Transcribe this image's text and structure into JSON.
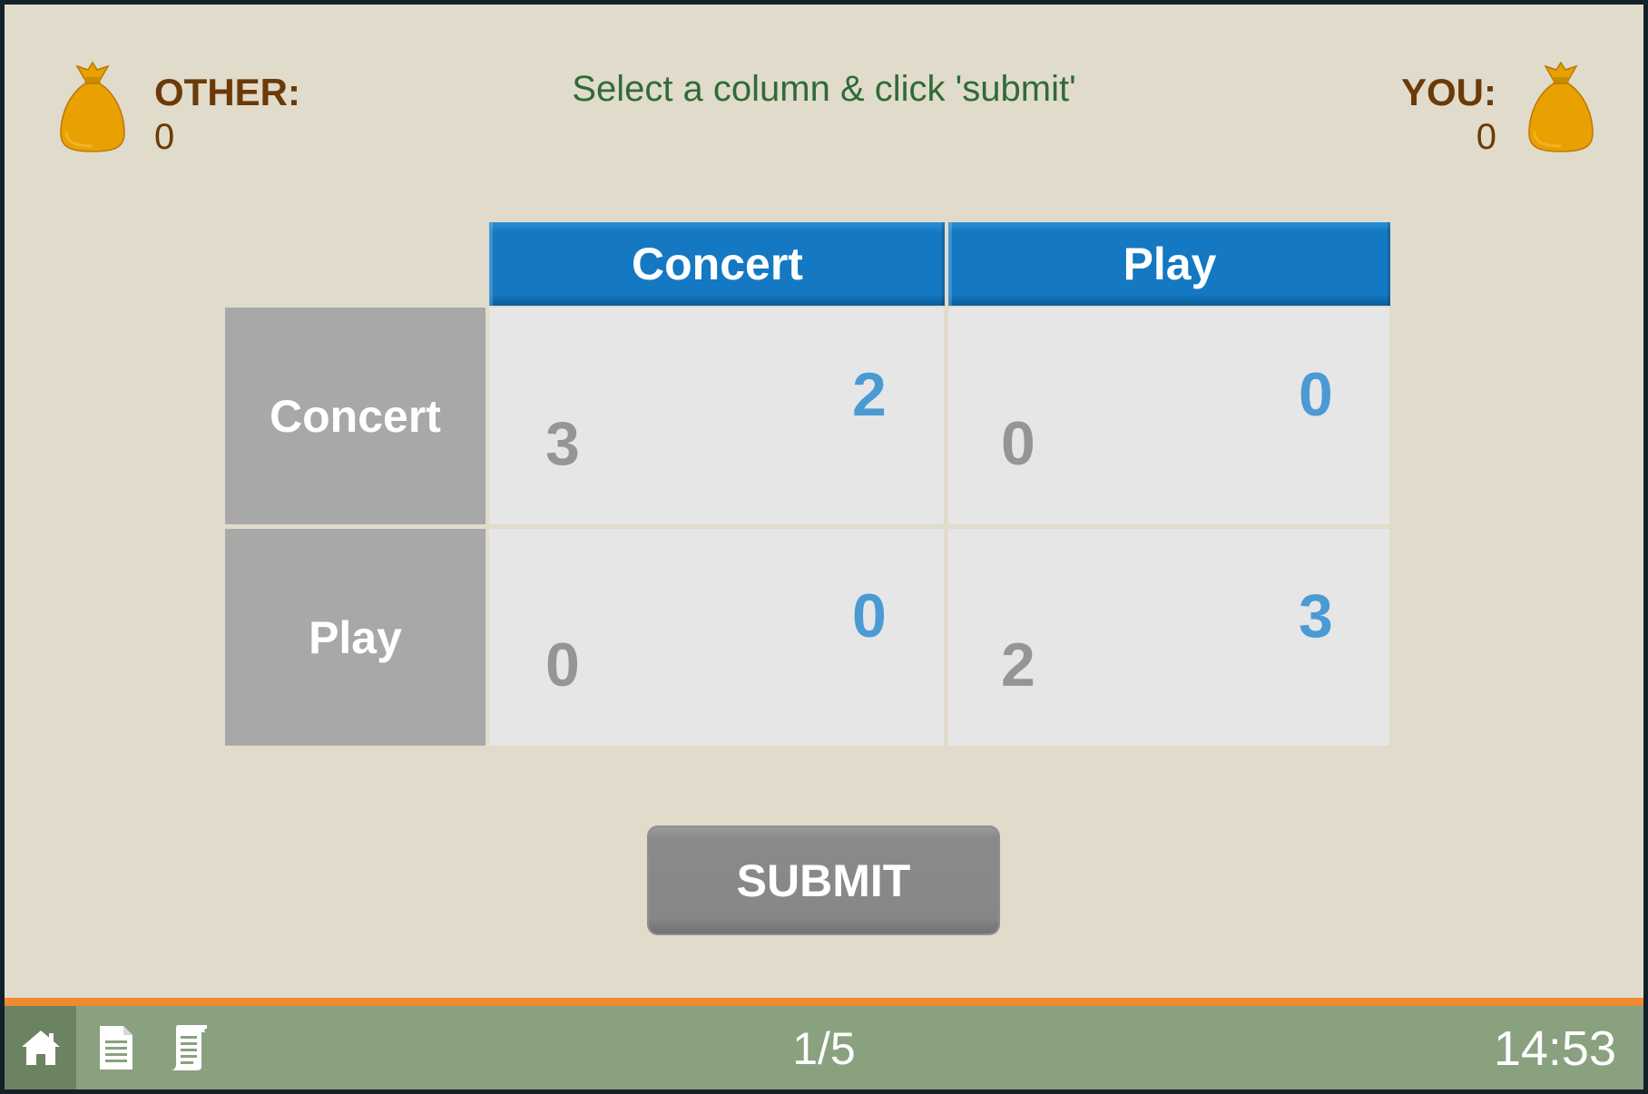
{
  "header": {
    "instruction": "Select a column & click 'submit'",
    "other": {
      "label": "OTHER:",
      "score": "0"
    },
    "you": {
      "label": "YOU:",
      "score": "0"
    }
  },
  "matrix": {
    "column_headers": [
      "Concert",
      "Play"
    ],
    "row_headers": [
      "Concert",
      "Play"
    ],
    "cells": [
      [
        {
          "other": "3",
          "you": "2"
        },
        {
          "other": "0",
          "you": "0"
        }
      ],
      [
        {
          "other": "0",
          "you": "0"
        },
        {
          "other": "2",
          "you": "3"
        }
      ]
    ]
  },
  "submit_label": "SUBMIT",
  "footer": {
    "page": "1/5",
    "time": "14:53",
    "icons": [
      "home-icon",
      "document-icon",
      "scroll-icon"
    ]
  },
  "colors": {
    "background": "#e1dbcb",
    "column_header": "#1478c2",
    "row_header": "#a8a8a8",
    "cell": "#e6e6e6",
    "payoff_other": "#959595",
    "payoff_you": "#4a9ad4",
    "footer": "#89a17f",
    "accent_bar": "#ee8a2f",
    "score_text": "#6b3a08",
    "instruction_text": "#2f6b38"
  }
}
